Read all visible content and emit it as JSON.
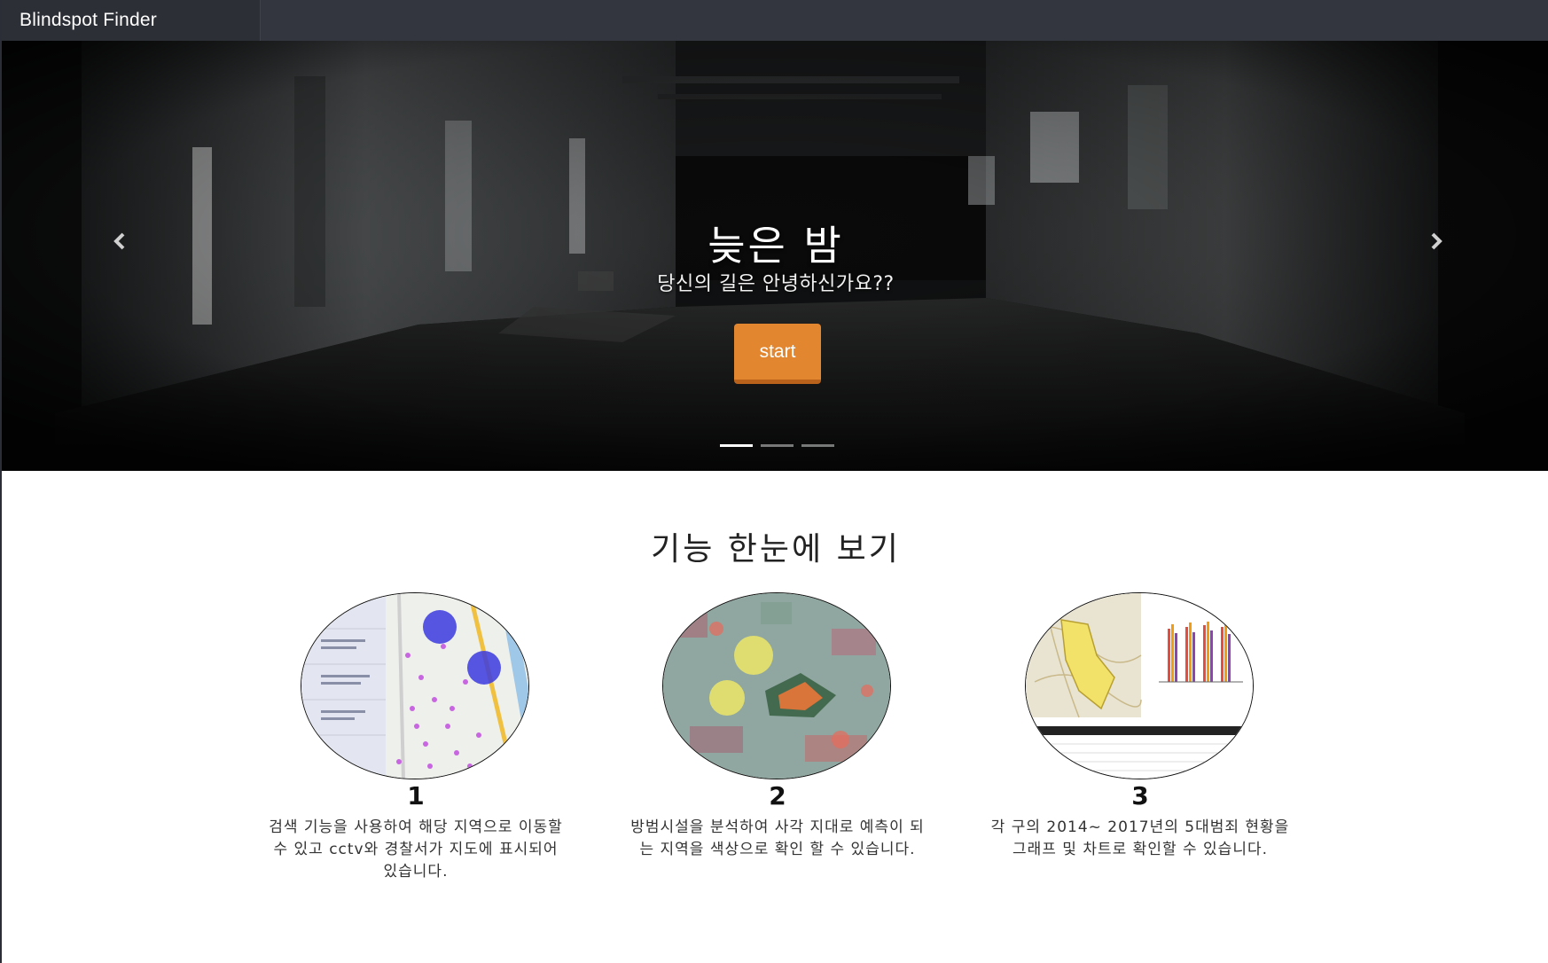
{
  "navbar": {
    "brand": "Blindspot Finder"
  },
  "hero": {
    "title": "늦은 밤",
    "subtitle": "당신의 길은 안녕하신가요??",
    "start_label": "start",
    "prev_icon": "chevron-left-icon",
    "next_icon": "chevron-right-icon",
    "slide_count": 3,
    "active_slide": 1
  },
  "features": {
    "title": "기능 한눈에 보기",
    "items": [
      {
        "number": "1",
        "description": "검색 기능을 사용하여 해당 지역으로 이동할 수 있고 cctv와 경찰서가 지도에 표시되어 있습니다."
      },
      {
        "number": "2",
        "description": "방범시설을 분석하여 사각 지대로 예측이 되는 지역을 색상으로 확인 할 수 있습니다."
      },
      {
        "number": "3",
        "description": "각 구의 2014~ 2017년의 5대범죄 현황을 그래프 및 차트로 확인할 수 있습니다."
      }
    ]
  },
  "colors": {
    "navbar": "#33363f",
    "brand_bg": "#2c2f36",
    "accent": "#e28730"
  }
}
